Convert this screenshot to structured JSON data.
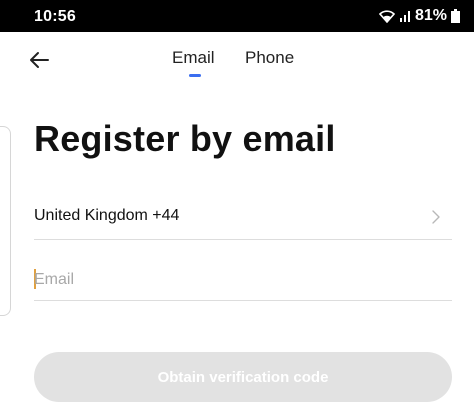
{
  "status_bar": {
    "time": "10:56",
    "battery": "81%",
    "icons": [
      "wifi-icon",
      "signal-icon",
      "battery-icon"
    ]
  },
  "nav": {
    "back_icon": "back-arrow-icon",
    "tabs": [
      {
        "label": "Email",
        "selected": true
      },
      {
        "label": "Phone",
        "selected": false
      }
    ],
    "indicator_color": "#3b6ef0"
  },
  "main": {
    "title": "Register by email",
    "country": {
      "label": "United Kingdom +44",
      "icon": "chevron-right-icon"
    },
    "email": {
      "value": "",
      "placeholder": "Email"
    },
    "obtain_button": {
      "label": "Obtain verification code",
      "enabled": false,
      "background": "#e2e2e2"
    }
  }
}
